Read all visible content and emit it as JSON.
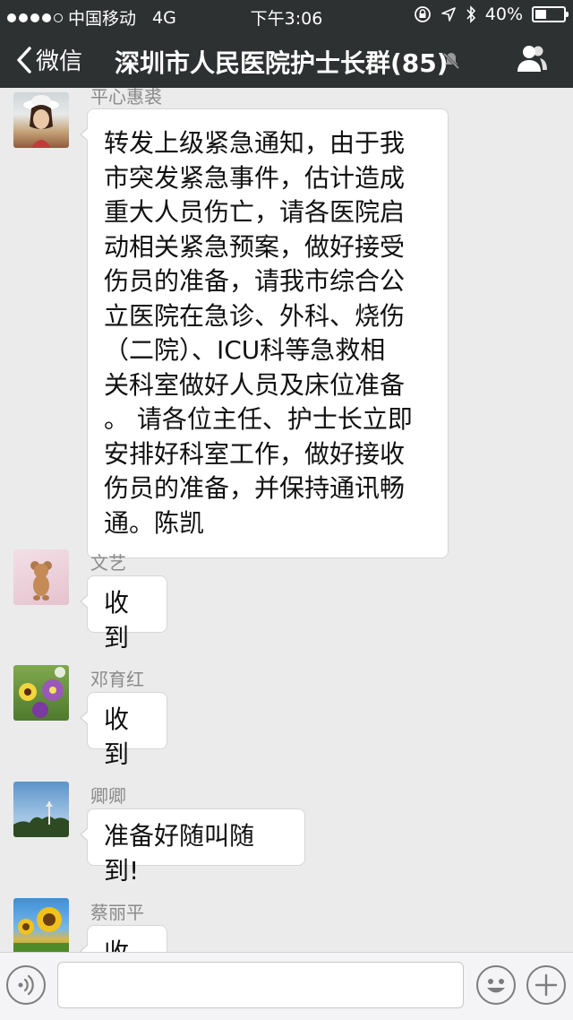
{
  "status_bar": {
    "carrier": "中国移动",
    "network": "4G",
    "time": "下午3:06",
    "battery": "40%",
    "battery_level": 0.4
  },
  "nav": {
    "back_label": "微信",
    "title": "深圳市人民医院护士长群(85)"
  },
  "messages": [
    {
      "sender": "平心惠裘",
      "text": [
        "转发上级紧急通知，由于我",
        "市突发紧急事件，估计造成",
        "重大人员伤亡，请各医院启",
        "动相关紧急预案，做好接受",
        "伤员的准备，请我市综合公",
        "立医院在急诊、外科、烧伤",
        "（二院）、ICU科等急救相",
        "关科室做好人员及床位准备",
        "。 请各位主任、护士长立即",
        "安排好科室工作，做好接收",
        "伤员的准备，并保持通讯畅",
        "通。陈凯"
      ]
    },
    {
      "sender": "文艺",
      "text": [
        "收到"
      ]
    },
    {
      "sender": "邓育红",
      "text": [
        "收到"
      ]
    },
    {
      "sender": "卿卿",
      "text": [
        "准备好随叫随到!"
      ]
    },
    {
      "sender": "蔡丽平",
      "text": [
        "收到"
      ]
    }
  ],
  "input_bar": {
    "placeholder": ""
  }
}
